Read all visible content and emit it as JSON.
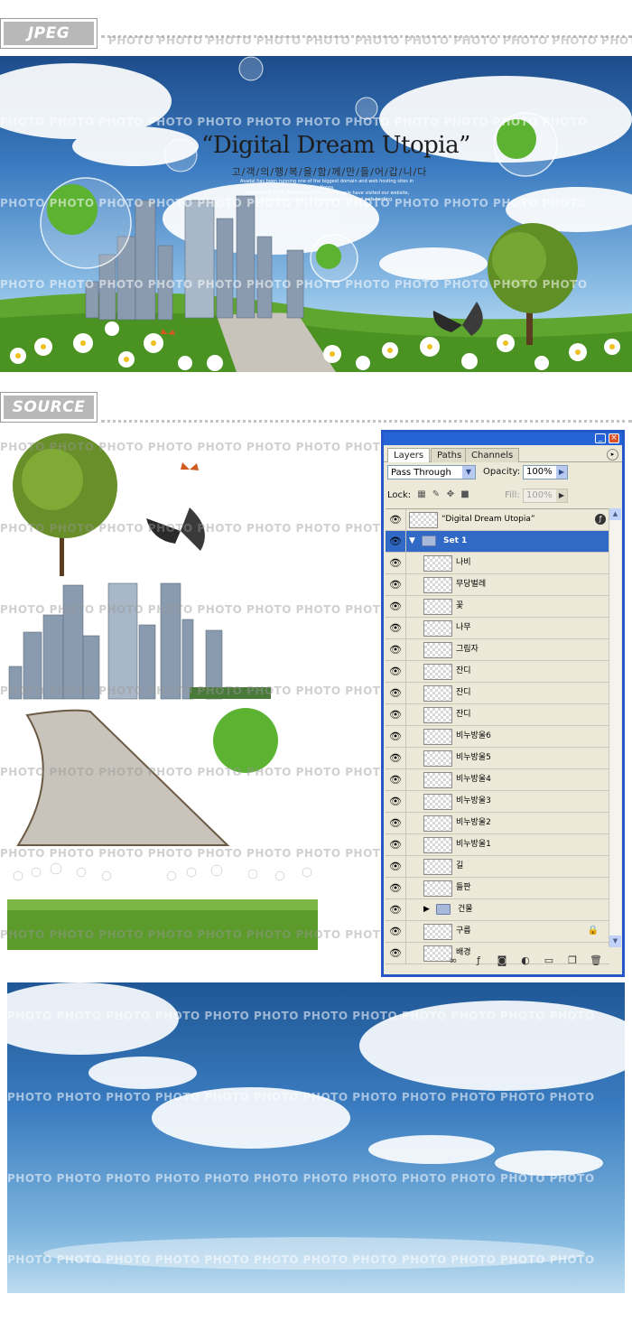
{
  "sections": {
    "jpeg_label": "JPEG",
    "source_label": "SOURCE"
  },
  "watermark": "PHOTO",
  "poster": {
    "headline": "“Digital Dream Utopia”",
    "subline": "고/객/의/행/복/을/함/께/만/들/어/갑/니/다",
    "blurb": [
      "Asadal has been running one of the biggest domain and web hosting sites in Korea",
      "since March 1998. More than 8,000,000 people have visited our website,",
      "www.asadal.com, for domain registration and web hosting."
    ]
  },
  "layers_panel": {
    "tabs": [
      "Layers",
      "Paths",
      "Channels"
    ],
    "active_tab": "Layers",
    "blend_mode": "Pass Through",
    "opacity_label": "Opacity:",
    "opacity_value": "100%",
    "lock_label": "Lock:",
    "fill_label": "Fill:",
    "fill_value": "100%",
    "layers": [
      {
        "name": "“Digital Dream Utopia”",
        "kind": "text-layer",
        "indent": 0
      },
      {
        "name": "Set 1",
        "kind": "group-open",
        "indent": 0,
        "selected": true
      },
      {
        "name": "나비",
        "kind": "layer",
        "indent": 1
      },
      {
        "name": "무당벌레",
        "kind": "layer",
        "indent": 1
      },
      {
        "name": "꽃",
        "kind": "layer",
        "indent": 1
      },
      {
        "name": "나무",
        "kind": "layer",
        "indent": 1
      },
      {
        "name": "그림자",
        "kind": "layer",
        "indent": 1
      },
      {
        "name": "잔디",
        "kind": "layer",
        "indent": 1
      },
      {
        "name": "잔디",
        "kind": "layer",
        "indent": 1
      },
      {
        "name": "잔디",
        "kind": "layer",
        "indent": 1
      },
      {
        "name": "비누방울6",
        "kind": "layer",
        "indent": 1
      },
      {
        "name": "비누방울5",
        "kind": "layer",
        "indent": 1
      },
      {
        "name": "비누방울4",
        "kind": "layer",
        "indent": 1
      },
      {
        "name": "비누방울3",
        "kind": "layer",
        "indent": 1
      },
      {
        "name": "비누방울2",
        "kind": "layer",
        "indent": 1
      },
      {
        "name": "비누방울1",
        "kind": "layer",
        "indent": 1
      },
      {
        "name": "길",
        "kind": "layer",
        "indent": 1
      },
      {
        "name": "들판",
        "kind": "layer",
        "indent": 1
      },
      {
        "name": "건물",
        "kind": "group-closed",
        "indent": 1
      },
      {
        "name": "구름",
        "kind": "layer",
        "indent": 1,
        "locked": true
      },
      {
        "name": "배경",
        "kind": "layer",
        "indent": 1
      }
    ]
  },
  "colors": {
    "panel_border": "#2457c8",
    "selection": "#3169c6",
    "panel_bg": "#ece9d8"
  }
}
